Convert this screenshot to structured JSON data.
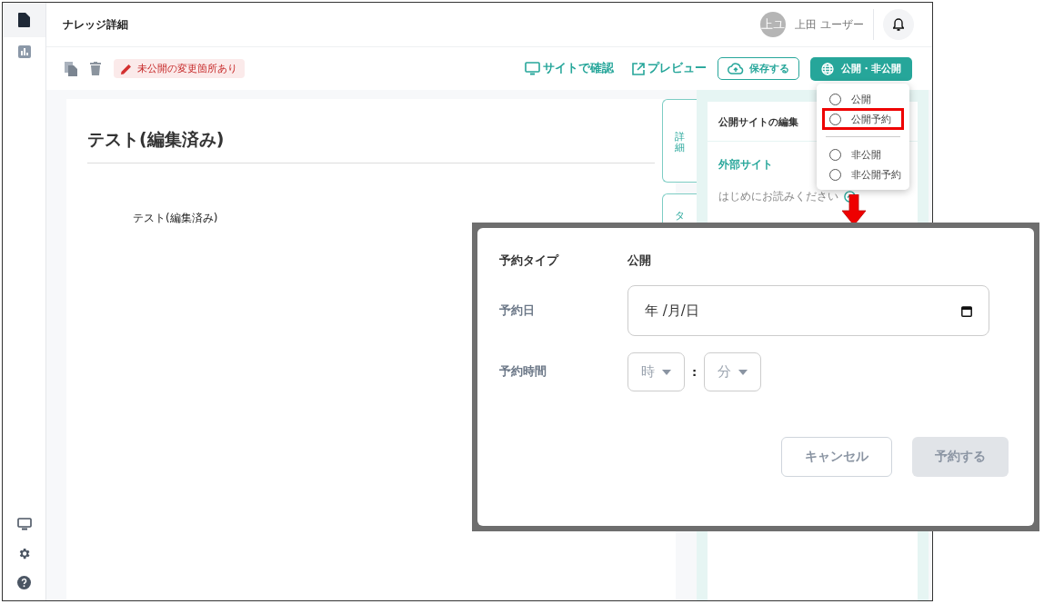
{
  "sidebar": {
    "nav_items": [
      {
        "kind": "document",
        "selected": true
      },
      {
        "kind": "chart",
        "selected": false
      }
    ],
    "bottom_items": [
      {
        "kind": "monitor"
      },
      {
        "kind": "gear"
      },
      {
        "kind": "help"
      }
    ]
  },
  "header": {
    "title": "ナレッジ詳細",
    "user": {
      "initials": "上ユ",
      "name": "上田 ユーザー"
    }
  },
  "toolbar": {
    "status_badge": "未公開の変更箇所あり",
    "links": [
      {
        "kind": "monitor",
        "label": "サイトで確認"
      },
      {
        "kind": "external",
        "label": "プレビュー"
      }
    ],
    "save_button": "保存する",
    "publish_button": "公開・非公開"
  },
  "publish_menu": {
    "groups": [
      [
        {
          "label": "公開",
          "selected": false,
          "annotated": false
        },
        {
          "label": "公開予約",
          "selected": false,
          "annotated": true
        }
      ],
      [
        {
          "label": "非公開",
          "selected": false,
          "annotated": false
        },
        {
          "label": "非公開予約",
          "selected": false,
          "annotated": false
        }
      ]
    ]
  },
  "article": {
    "title": "テスト(編集済み)",
    "body": "テスト(編集済み)"
  },
  "side_tabs": [
    {
      "label": "詳細"
    },
    {
      "label": "タ"
    }
  ],
  "side_panel": {
    "title": "公開サイトの編集",
    "section": "外部サイト",
    "item": "はじめにお読みください"
  },
  "dialog": {
    "type_label": "予約タイプ",
    "type_value": "公開",
    "date_label": "予約日",
    "date_placeholder": "年 /月/日",
    "time_label": "予約時間",
    "hour_placeholder": "時",
    "separator": ":",
    "minute_placeholder": "分",
    "cancel_button": "キャンセル",
    "submit_button": {
      "label": "予約する",
      "disabled": true
    }
  }
}
